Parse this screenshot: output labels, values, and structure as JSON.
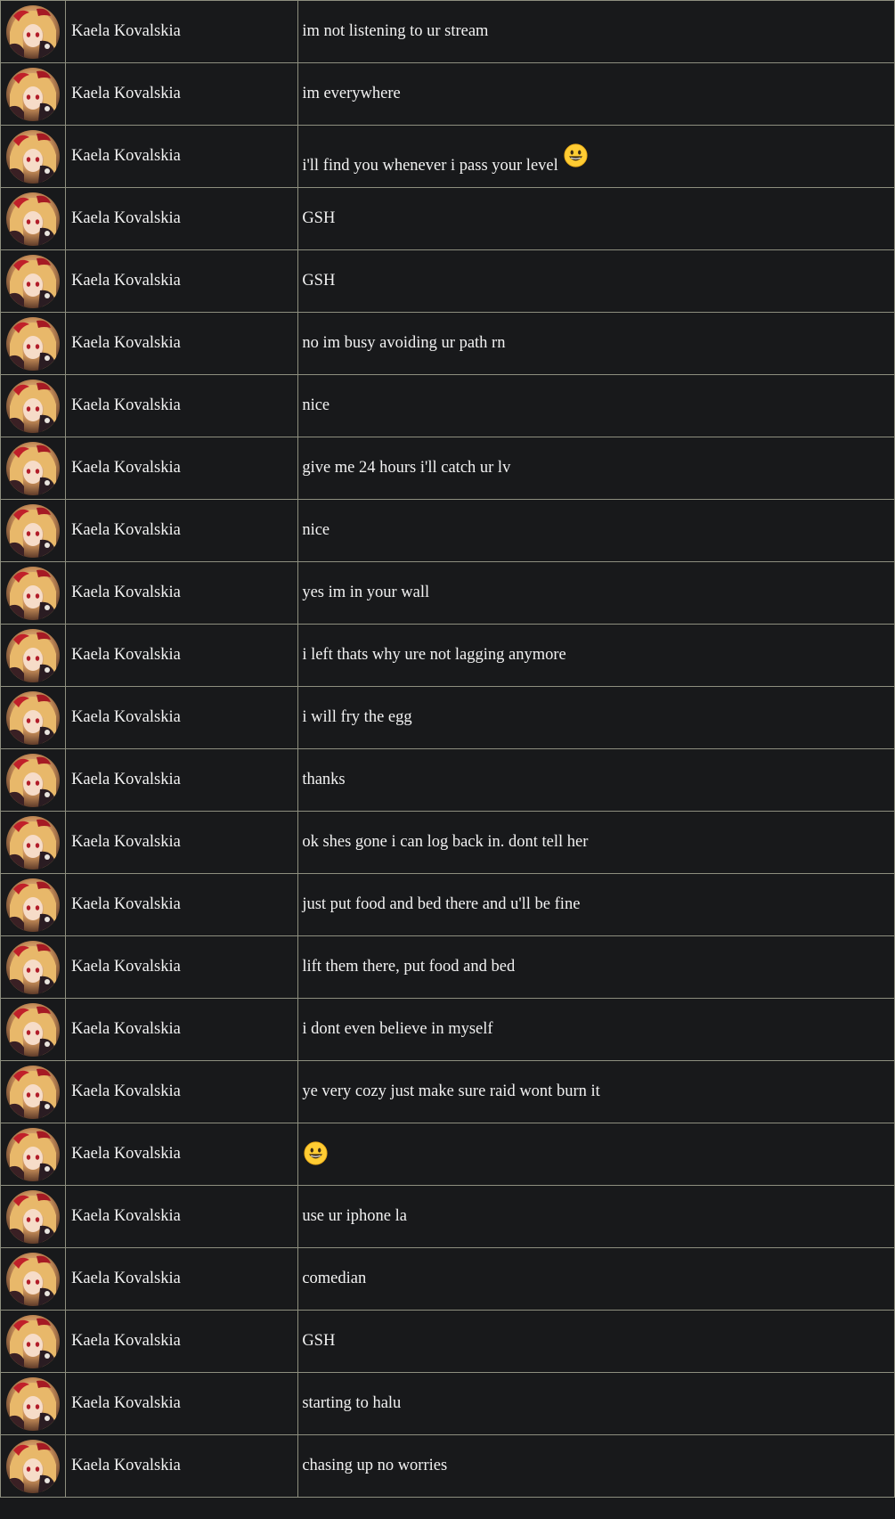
{
  "avatar_icon": "anime-avatar-icon",
  "emoji_icon": "grinning-face-emoji",
  "colors": {
    "background": "#18191b",
    "border": "#8e8f7f",
    "text": "#f2f2f2"
  },
  "messages": [
    {
      "user": "Kaela Kovalskia",
      "text": "im not listening to ur stream",
      "emoji": false
    },
    {
      "user": "Kaela Kovalskia",
      "text": "im everywhere",
      "emoji": false
    },
    {
      "user": "Kaela Kovalskia",
      "text": "i'll find you whenever i pass your level",
      "emoji": true
    },
    {
      "user": "Kaela Kovalskia",
      "text": "GSH",
      "emoji": false
    },
    {
      "user": "Kaela Kovalskia",
      "text": "GSH",
      "emoji": false
    },
    {
      "user": "Kaela Kovalskia",
      "text": "no im busy avoiding ur path rn",
      "emoji": false
    },
    {
      "user": "Kaela Kovalskia",
      "text": "nice",
      "emoji": false
    },
    {
      "user": "Kaela Kovalskia",
      "text": "give me 24 hours i'll catch ur lv",
      "emoji": false
    },
    {
      "user": "Kaela Kovalskia",
      "text": "nice",
      "emoji": false
    },
    {
      "user": "Kaela Kovalskia",
      "text": "yes im in your wall",
      "emoji": false
    },
    {
      "user": "Kaela Kovalskia",
      "text": "i left thats why ure not lagging anymore",
      "emoji": false
    },
    {
      "user": "Kaela Kovalskia",
      "text": "i will fry the egg",
      "emoji": false
    },
    {
      "user": "Kaela Kovalskia",
      "text": "thanks",
      "emoji": false
    },
    {
      "user": "Kaela Kovalskia",
      "text": "ok shes gone i can log back in. dont tell her",
      "emoji": false
    },
    {
      "user": "Kaela Kovalskia",
      "text": "just put food and bed there and u'll be fine",
      "emoji": false
    },
    {
      "user": "Kaela Kovalskia",
      "text": "lift them there, put food and bed",
      "emoji": false
    },
    {
      "user": "Kaela Kovalskia",
      "text": "i dont even believe in myself",
      "emoji": false
    },
    {
      "user": "Kaela Kovalskia",
      "text": "ye very cozy just make sure raid wont burn it",
      "emoji": false
    },
    {
      "user": "Kaela Kovalskia",
      "text": "",
      "emoji": true
    },
    {
      "user": "Kaela Kovalskia",
      "text": "use ur iphone la",
      "emoji": false
    },
    {
      "user": "Kaela Kovalskia",
      "text": "comedian",
      "emoji": false
    },
    {
      "user": "Kaela Kovalskia",
      "text": "GSH",
      "emoji": false
    },
    {
      "user": "Kaela Kovalskia",
      "text": "starting to halu",
      "emoji": false
    },
    {
      "user": "Kaela Kovalskia",
      "text": "chasing up no worries",
      "emoji": false
    }
  ]
}
